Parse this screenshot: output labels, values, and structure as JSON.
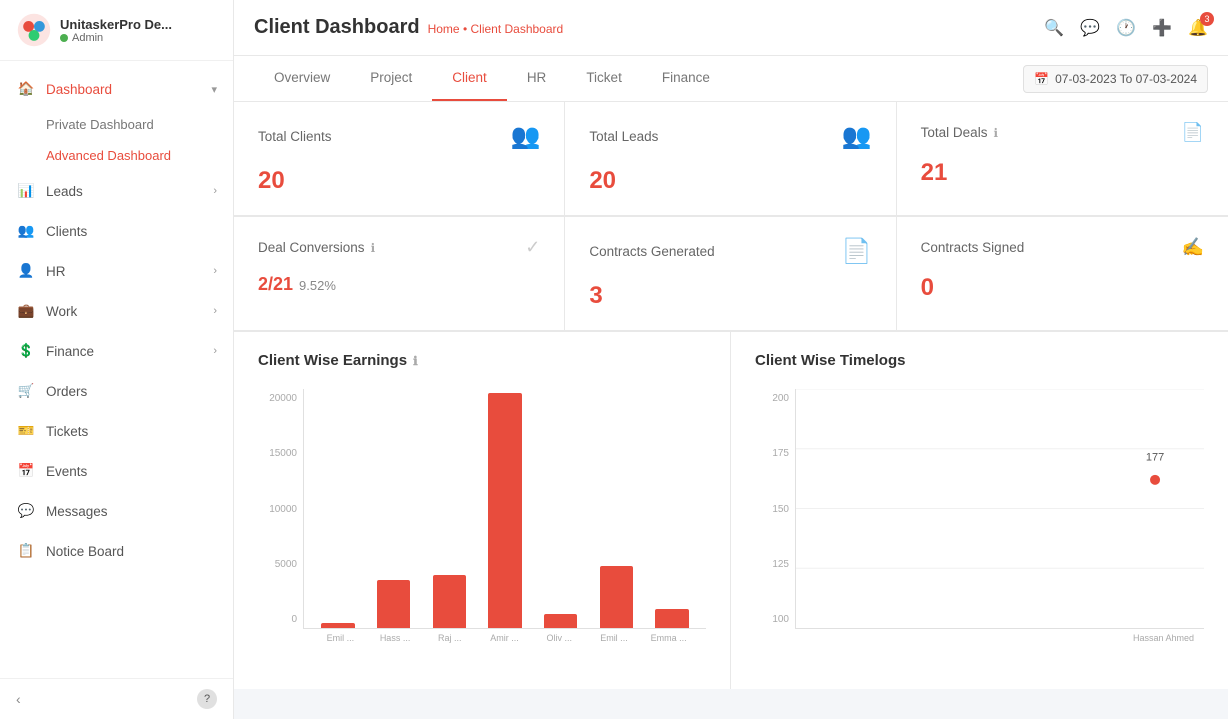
{
  "brand": {
    "name": "UnitaskerPro De...",
    "role": "Admin"
  },
  "sidebar": {
    "items": [
      {
        "id": "dashboard",
        "label": "Dashboard",
        "icon": "🏠",
        "active": true,
        "hasChevron": true
      },
      {
        "id": "leads",
        "label": "Leads",
        "icon": "📊",
        "hasChevron": true
      },
      {
        "id": "clients",
        "label": "Clients",
        "icon": "👥",
        "hasChevron": false
      },
      {
        "id": "hr",
        "label": "HR",
        "icon": "👤",
        "hasChevron": true
      },
      {
        "id": "work",
        "label": "Work",
        "icon": "💼",
        "hasChevron": true
      },
      {
        "id": "finance",
        "label": "Finance",
        "icon": "💲",
        "hasChevron": true
      },
      {
        "id": "orders",
        "label": "Orders",
        "icon": "🛒",
        "hasChevron": false
      },
      {
        "id": "tickets",
        "label": "Tickets",
        "icon": "🎫",
        "hasChevron": false
      },
      {
        "id": "events",
        "label": "Events",
        "icon": "📅",
        "hasChevron": false
      },
      {
        "id": "messages",
        "label": "Messages",
        "icon": "💬",
        "hasChevron": false
      },
      {
        "id": "notice-board",
        "label": "Notice Board",
        "icon": "📋",
        "hasChevron": false
      }
    ],
    "sub_items": [
      {
        "id": "private-dashboard",
        "label": "Private Dashboard"
      },
      {
        "id": "advanced-dashboard",
        "label": "Advanced Dashboard",
        "active": true
      }
    ]
  },
  "topbar": {
    "title": "Client Dashboard",
    "breadcrumb_home": "Home",
    "breadcrumb_sep": "•",
    "breadcrumb_current": "Client Dashboard",
    "notification_count": "3"
  },
  "tabs": [
    {
      "id": "overview",
      "label": "Overview"
    },
    {
      "id": "project",
      "label": "Project"
    },
    {
      "id": "client",
      "label": "Client",
      "active": true
    },
    {
      "id": "hr",
      "label": "HR"
    },
    {
      "id": "ticket",
      "label": "Ticket"
    },
    {
      "id": "finance",
      "label": "Finance"
    }
  ],
  "date_range": "07-03-2023 To 07-03-2024",
  "stats": [
    {
      "id": "total-clients",
      "title": "Total Clients",
      "value": "20",
      "icon": "👥"
    },
    {
      "id": "total-leads",
      "title": "Total Leads",
      "value": "20",
      "icon": "👥"
    },
    {
      "id": "total-deals",
      "title": "Total Deals",
      "value": "21",
      "icon": "📄",
      "has_info": true
    }
  ],
  "stats2": [
    {
      "id": "deal-conversions",
      "title": "Deal Conversions",
      "fraction": "2/21",
      "percent": "9.52%",
      "has_info": true,
      "icon": "✓"
    },
    {
      "id": "contracts-generated",
      "title": "Contracts Generated",
      "value": "3",
      "icon": "📄"
    },
    {
      "id": "contracts-signed",
      "title": "Contracts Signed",
      "value": "0",
      "icon": "✍",
      "has_export": true
    }
  ],
  "charts": {
    "earnings": {
      "title": "Client Wise Earnings",
      "has_info": true,
      "y_labels": [
        "20000",
        "15000",
        "10000",
        "5000",
        "0"
      ],
      "bars": [
        {
          "label": "Emil ...",
          "height_pct": 2
        },
        {
          "label": "Hass ...",
          "height_pct": 20
        },
        {
          "label": "Raj ...",
          "height_pct": 22
        },
        {
          "label": "Amir ...",
          "height_pct": 98
        },
        {
          "label": "Oliv ...",
          "height_pct": 6
        },
        {
          "label": "Emil ...",
          "height_pct": 26
        },
        {
          "label": "Emma ...",
          "height_pct": 8
        }
      ]
    },
    "timelogs": {
      "title": "Client Wise Timelogs",
      "y_labels": [
        "200",
        "175",
        "150",
        "125",
        "100"
      ],
      "point_label": "177",
      "point_x_pct": 88,
      "point_y_pct": 38,
      "x_label": "Hassan Ahmed"
    }
  }
}
